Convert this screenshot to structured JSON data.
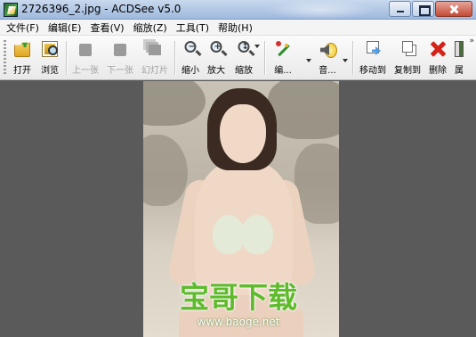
{
  "window": {
    "title": "2726396_2.jpg - ACDSee v5.0"
  },
  "menu": [
    {
      "label": "文件(F)"
    },
    {
      "label": "编辑(E)"
    },
    {
      "label": "查看(V)"
    },
    {
      "label": "缩放(Z)"
    },
    {
      "label": "工具(T)"
    },
    {
      "label": "帮助(H)"
    }
  ],
  "toolbar": {
    "open": "打开",
    "browse": "浏览",
    "prev": "上一张",
    "next": "下一张",
    "slideshow": "幻灯片",
    "zoom_out": "缩小",
    "zoom_in": "放大",
    "zoom": "缩放",
    "edit": "编...",
    "audio": "音...",
    "move_to": "移动到",
    "copy_to": "复制到",
    "delete": "删除",
    "properties": "属",
    "more": "»"
  },
  "watermark": {
    "text": "宝哥下载",
    "url": "www.baoge.net"
  },
  "colors": {
    "titlebar": "#b5cae6",
    "watermark_green": "#5dbb2c",
    "viewer_bg": "#5a5a5a"
  }
}
